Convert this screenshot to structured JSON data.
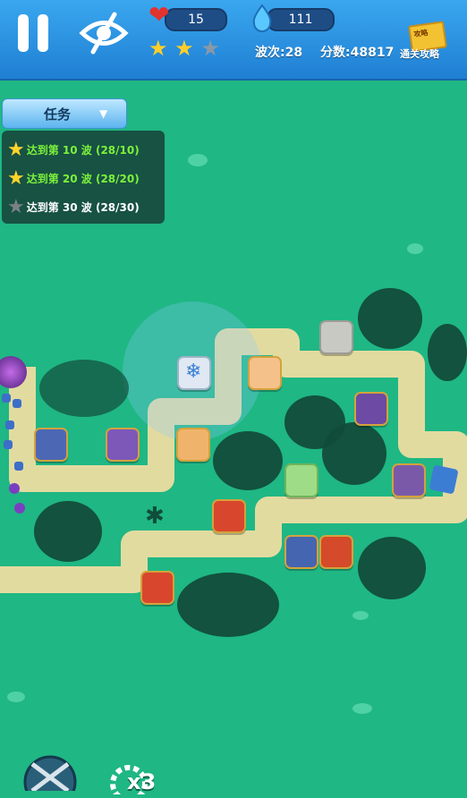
{
  "hud": {
    "lives": "15",
    "mana": "111",
    "wave_text": "波次:28",
    "score_text": "分数:48817",
    "strategy_badge": "攻略",
    "strategy_label": "通关攻略",
    "stars_earned": 2,
    "stars_total": 3,
    "icons": [
      "pause-icon",
      "eye-slash-icon",
      "heart-icon",
      "water-drop-icon",
      "star-icon"
    ]
  },
  "quest": {
    "button_label": "任务",
    "items": [
      {
        "text": "达到第 10 波 (28/10)",
        "done": true
      },
      {
        "text": "达到第 20 波 (28/20)",
        "done": true
      },
      {
        "text": "达到第 30 波 (28/30)",
        "done": false
      }
    ]
  },
  "bottom": {
    "speed_label": "x3",
    "icons": [
      "crossed-swords-icon",
      "gear-speed-icon"
    ]
  },
  "colors": {
    "grass": "#1fb784",
    "path": "#e2dba0",
    "topbar": "#2d93e0",
    "done_text": "#7cf03b",
    "pending_text": "#ffffff"
  },
  "towers": [
    {
      "type": "ice"
    },
    {
      "type": "fire-spear"
    },
    {
      "type": "poison"
    },
    {
      "type": "fire-spear"
    },
    {
      "type": "dark"
    },
    {
      "type": "dark"
    },
    {
      "type": "water"
    },
    {
      "type": "fire"
    },
    {
      "type": "heal"
    },
    {
      "type": "dark"
    },
    {
      "type": "water"
    },
    {
      "type": "fire"
    },
    {
      "type": "fire"
    },
    {
      "type": "rock"
    }
  ]
}
